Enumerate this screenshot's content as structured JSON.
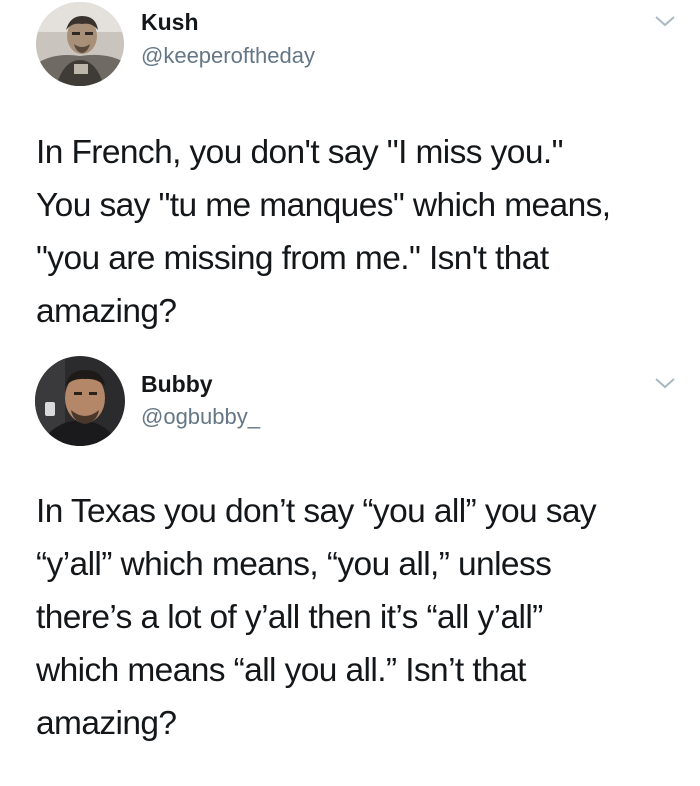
{
  "tweets": [
    {
      "name": "Kush",
      "handle": "@keeperoftheday",
      "text": "In French, you don't say \"I miss you.\"\nYou say \"tu me manques\" which means,\n\"you are missing from me.\" Isn't that\namazing?",
      "avatar_icon": "user-photo",
      "menu_icon": "chevron-down-icon"
    },
    {
      "name": "Bubby",
      "handle": "@ogbubby_",
      "text": "In Texas you don’t say “you all” you say\n“y’all” which means, “you all,” unless\nthere’s a lot of y’all then it’s “all y’all”\nwhich means “all you all.” Isn’t that\namazing?",
      "avatar_icon": "user-photo",
      "menu_icon": "chevron-down-icon"
    }
  ],
  "colors": {
    "text": "#14171a",
    "secondary_text": "#657786",
    "chevron": "#aab8c2",
    "background": "#ffffff"
  }
}
